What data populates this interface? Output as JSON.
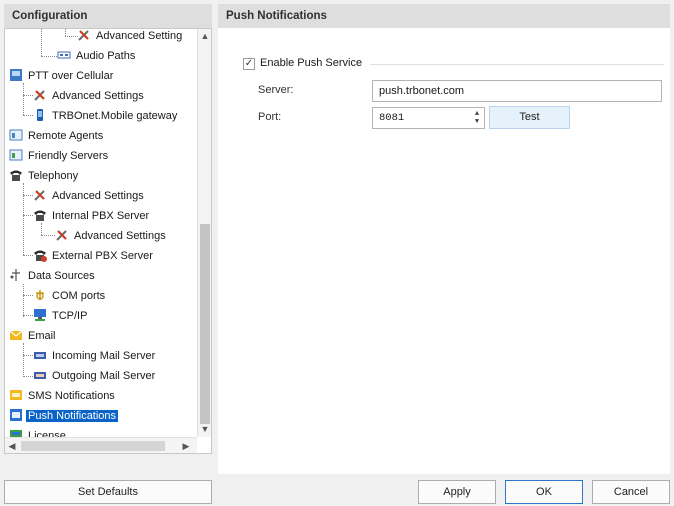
{
  "left_panel": {
    "header": "Configuration"
  },
  "right_panel": {
    "header": "Push Notifications"
  },
  "tree": {
    "items": [
      {
        "label": "Advanced Setting",
        "icon": "wrench-icon"
      },
      {
        "label": "Audio Paths",
        "icon": "audio-paths-icon"
      },
      {
        "label": "PTT over Cellular",
        "icon": "ptt-icon"
      },
      {
        "label": "Advanced Settings",
        "icon": "wrench-icon"
      },
      {
        "label": "TRBOnet.Mobile gateway",
        "icon": "mobile-icon"
      },
      {
        "label": "Remote Agents",
        "icon": "agent-icon"
      },
      {
        "label": "Friendly Servers",
        "icon": "server-icon"
      },
      {
        "label": "Telephony",
        "icon": "phone-icon"
      },
      {
        "label": "Advanced Settings",
        "icon": "wrench-icon"
      },
      {
        "label": "Internal PBX Server",
        "icon": "phone-icon"
      },
      {
        "label": "Advanced Settings",
        "icon": "wrench-icon"
      },
      {
        "label": "External PBX Server",
        "icon": "external-phone-icon"
      },
      {
        "label": "Data Sources",
        "icon": "data-sources-icon"
      },
      {
        "label": "COM ports",
        "icon": "com-port-icon"
      },
      {
        "label": "TCP/IP",
        "icon": "network-icon"
      },
      {
        "label": "Email",
        "icon": "email-icon"
      },
      {
        "label": "Incoming Mail Server",
        "icon": "incoming-mail-icon"
      },
      {
        "label": "Outgoing Mail Server",
        "icon": "outgoing-mail-icon"
      },
      {
        "label": "SMS Notifications",
        "icon": "sms-icon"
      },
      {
        "label": "Push Notifications",
        "icon": "push-icon",
        "selected": true
      },
      {
        "label": "License",
        "icon": "license-icon"
      }
    ]
  },
  "form": {
    "enable_label": "Enable Push Service",
    "enable_checked": true,
    "check_mark": "✓",
    "server_label": "Server:",
    "server_value": "push.trbonet.com",
    "port_label": "Port:",
    "port_value": "8081",
    "test_label": "Test"
  },
  "footer": {
    "set_defaults": "Set Defaults",
    "apply": "Apply",
    "ok": "OK",
    "cancel": "Cancel"
  },
  "colors": {
    "selection": "#0a63c6",
    "header_bg": "#dedede",
    "test_button_bg": "#e5f1fb"
  }
}
